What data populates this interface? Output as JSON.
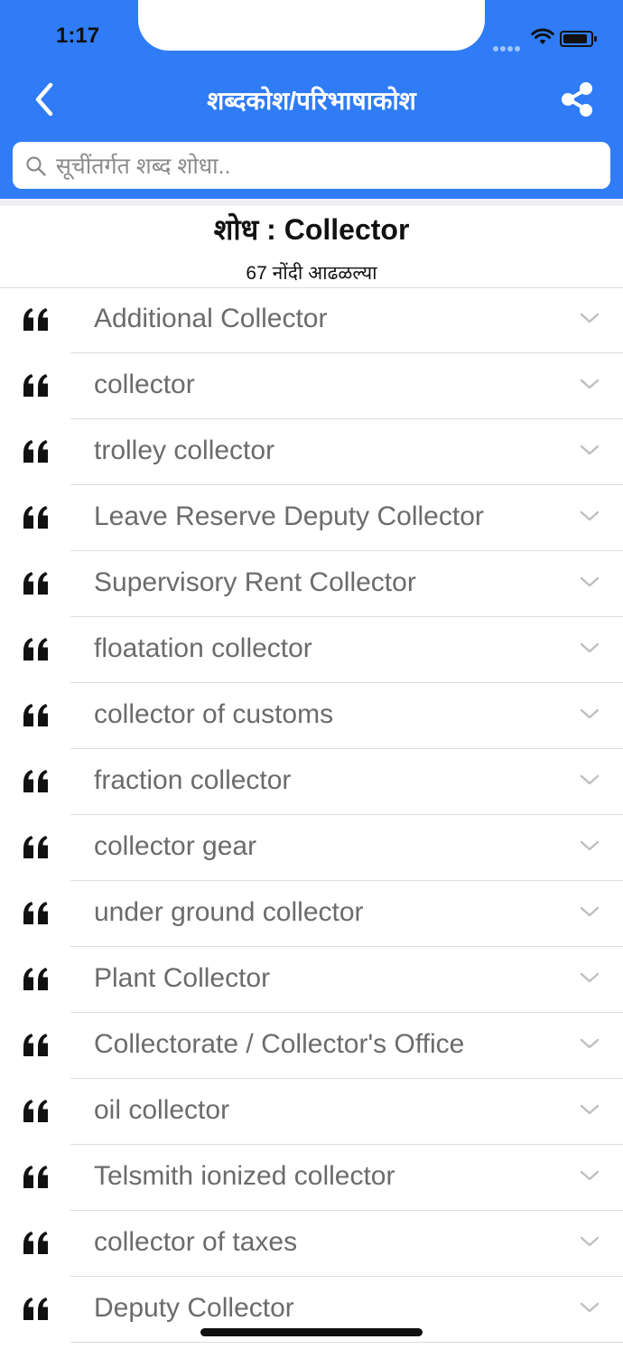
{
  "status_bar": {
    "time": "1:17"
  },
  "header": {
    "title": "शब्दकोश/परिभाषाकोश"
  },
  "search": {
    "placeholder": "सूचींतर्गत शब्द शोधा.."
  },
  "results": {
    "title": "शोध : Collector",
    "count_label": "67 नोंदी आढळल्या",
    "items": [
      "Additional Collector",
      "collector",
      "trolley collector",
      "Leave Reserve Deputy Collector",
      "Supervisory Rent Collector",
      "floatation collector",
      "collector of customs",
      "fraction collector",
      "collector gear",
      "under ground collector",
      "Plant Collector",
      "Collectorate / Collector's Office",
      "oil collector",
      "Telsmith ionized collector",
      "collector of taxes",
      "Deputy Collector"
    ]
  },
  "colors": {
    "accent": "#2f7cf6",
    "item_text": "#6b6b6b",
    "chevron": "#c0c0c0"
  },
  "icons": {
    "back": "chevron-left-icon",
    "share": "share-icon",
    "search": "search-icon",
    "quote": "quote-icon",
    "expand": "chevron-down-icon"
  }
}
